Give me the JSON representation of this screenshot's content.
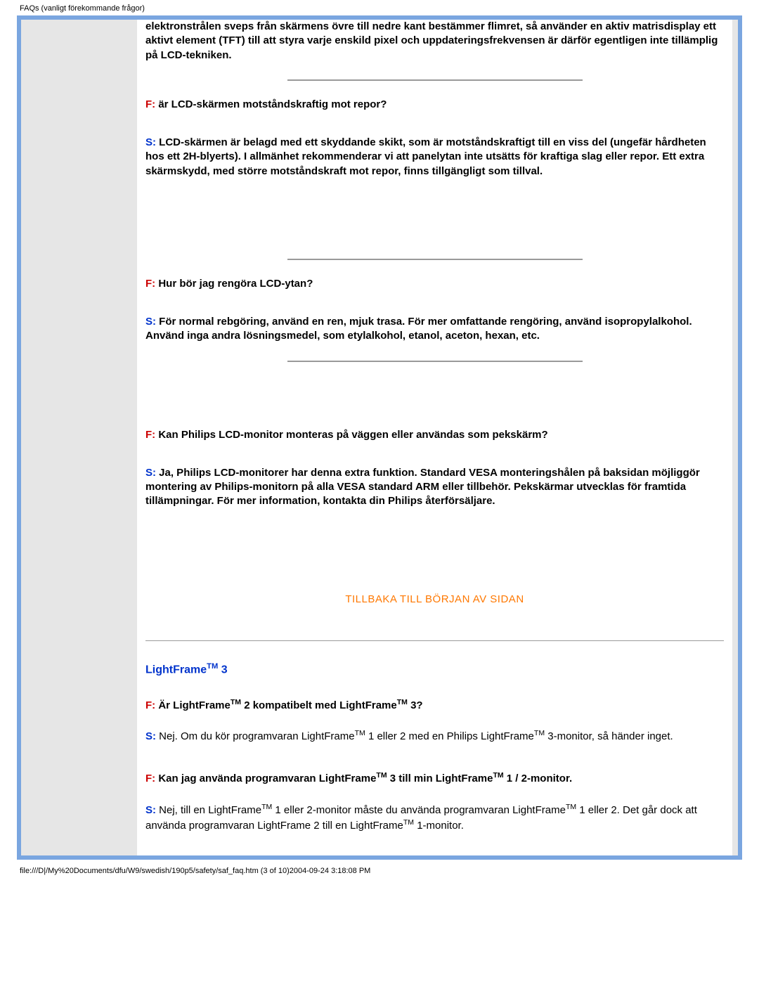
{
  "header": "FAQs (vanligt förekommande frågor)",
  "footer": "file:///D|/My%20Documents/dfu/W9/swedish/190p5/safety/saf_faq.htm (3 of 10)2004-09-24 3:18:08 PM",
  "intro_continuation": "elektronstrålen sveps från skärmens övre till nedre kant bestämmer flimret, så använder en aktiv matrisdisplay ett aktivt element (TFT) till att styra varje enskild pixel och uppdateringsfrekvensen är därför egentligen inte tillämplig på LCD-tekniken.",
  "qa1": {
    "q_label": "F:",
    "q_text": " är LCD-skärmen motståndskraftig mot repor?",
    "a_label": "S:",
    "a_text": " LCD-skärmen är belagd med ett skyddande skikt, som är motståndskraftigt till en viss del (ungefär hårdheten hos ett 2H-blyerts). I allmänhet rekommenderar vi att panelytan inte utsätts för kraftiga slag eller repor. Ett extra skärmskydd, med större motståndskraft mot repor, finns tillgängligt som tillval."
  },
  "qa2": {
    "q_label": "F:",
    "q_text": " Hur bör jag rengöra LCD-ytan?",
    "a_label": "S:",
    "a_text": " För normal rebgöring, använd en ren, mjuk trasa. För mer omfattande rengöring, använd isopropylalkohol. Använd inga andra lösningsmedel, som etylalkohol, etanol, aceton, hexan, etc."
  },
  "qa3": {
    "q_label": "F:",
    "q_text": " Kan Philips LCD-monitor monteras på väggen eller användas som pekskärm?",
    "a_label": "S:",
    "a_text": " Ja, Philips LCD-monitorer har denna extra funktion. Standard VESA monteringshålen på baksidan möjliggör montering av Philips-monitorn på alla VESA standard ARM eller tillbehör. Pekskärmar utvecklas för framtida tillämpningar. För mer information, kontakta din Philips återförsäljare."
  },
  "back_link": "TILLBAKA TILL BÖRJAN AV SIDAN",
  "section_title_base": "LightFrame",
  "section_title_suffix": " 3",
  "tm": "TM",
  "qa4": {
    "q_label": "F:",
    "q_pre": " Är LightFrame",
    "q_mid": " 2 kompatibelt med LightFrame",
    "q_end": " 3?",
    "a_label": "S:",
    "a_pre": " Nej. Om du kör programvaran LightFrame",
    "a_mid": " 1 eller 2 med en Philips LightFrame",
    "a_end": " 3-monitor, så händer inget."
  },
  "qa5": {
    "q_label": "F:",
    "q_pre": " Kan jag använda programvaran LightFrame",
    "q_mid": " 3 till min LightFrame",
    "q_end": " 1 / 2-monitor.",
    "a_label": "S:",
    "a_p1": " Nej, till en LightFrame",
    "a_p2": " 1 eller 2-monitor måste du använda programvaran LightFrame",
    "a_p3": " 1 eller 2. Det går dock att använda programvaran LightFrame 2 till en LightFrame",
    "a_p4": " 1-monitor."
  }
}
